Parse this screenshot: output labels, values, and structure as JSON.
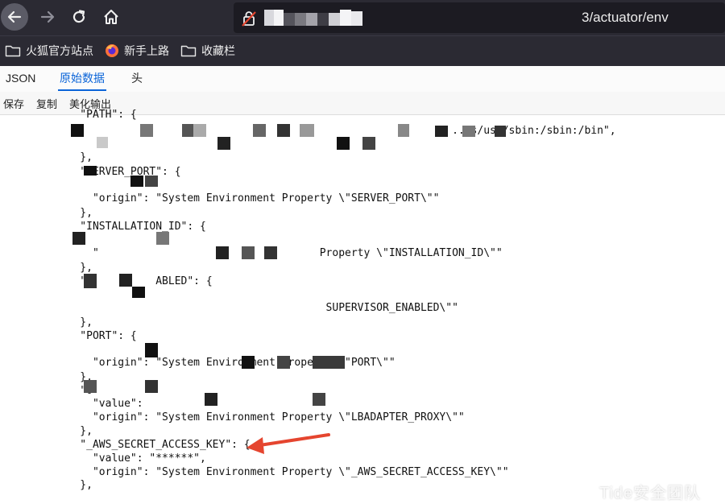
{
  "browser": {
    "url_suffix": "3/actuator/env",
    "bookmarks": [
      {
        "label": "火狐官方站点",
        "icon": "folder-icon"
      },
      {
        "label": "新手上路",
        "icon": "firefox-icon"
      },
      {
        "label": "收藏栏",
        "icon": "folder-icon"
      }
    ]
  },
  "viewer": {
    "tabs": [
      {
        "label": "JSON",
        "active": false
      },
      {
        "label": "原始数据",
        "active": true
      },
      {
        "label": "头",
        "active": false
      }
    ],
    "actions": [
      "保存",
      "复制",
      "美化输出"
    ]
  },
  "code": {
    "lines": [
      "    \"PATH\": {",
      "                                                               ...s/usr/sbin:/sbin:/bin\",",
      "    },",
      "    \"SERVER_PORT\": {",
      "      \"origin\": \"System Environment Property \\\"SERVER_PORT\\\"\"",
      "    },",
      "    \"INSTALLATION_ID\": {",
      "      \"                                   Property \\\"INSTALLATION_ID\\\"\"",
      "    },",
      "    \"S          ABLED\": {",
      "                                           SUPERVISOR_ENABLED\\\"\"",
      "    },",
      "    \"PORT\": {",
      "      \"origin\": \"System Environment Property \\\"PORT\\\"\"",
      "    },",
      "    \"O",
      "      \"value\":",
      "      \"origin\": \"System Environment Property \\\"LBADAPTER_PROXY\\\"\"",
      "    },",
      "    \"_AWS_SECRET_ACCESS_KEY\": {",
      "      \"value\": \"******\",",
      "      \"origin\": \"System Environment Property \\\"_AWS_SECRET_ACCESS_KEY\\\"\"",
      "    },"
    ]
  },
  "annotation": {
    "color": "#e5452f"
  },
  "watermark": "Tide安全团队"
}
